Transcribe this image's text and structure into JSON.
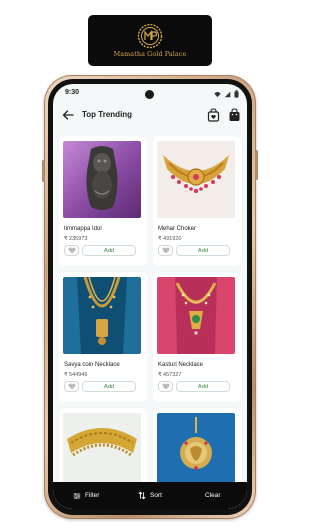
{
  "brand": {
    "logo_monogram": "MGP",
    "name": "Mamatha Gold Palace"
  },
  "status_bar": {
    "time": "9:30"
  },
  "app_bar": {
    "title": "Top Trending"
  },
  "products": [
    {
      "name": "timmappa Idol",
      "price": "₹ 235973",
      "add_label": "Add"
    },
    {
      "name": "Mehar Choker",
      "price": "₹ 491920",
      "add_label": "Add"
    },
    {
      "name": "Savya coin Necklace",
      "price": "₹ 544946",
      "add_label": "Add"
    },
    {
      "name": "Kasturi Necklace",
      "price": "₹ 457327",
      "add_label": "Add"
    },
    {
      "name": "",
      "price": "",
      "add_label": ""
    },
    {
      "name": "",
      "price": "",
      "add_label": ""
    }
  ],
  "bottom_bar": {
    "filter_label": "Filter",
    "sort_label": "Sort",
    "clear_label": "Clear"
  },
  "colors": {
    "brand_gold": "#d4a74c",
    "bar_black": "#0b0b0b",
    "add_green": "#3b8a45",
    "screen_bg": "#f4f8f9"
  }
}
